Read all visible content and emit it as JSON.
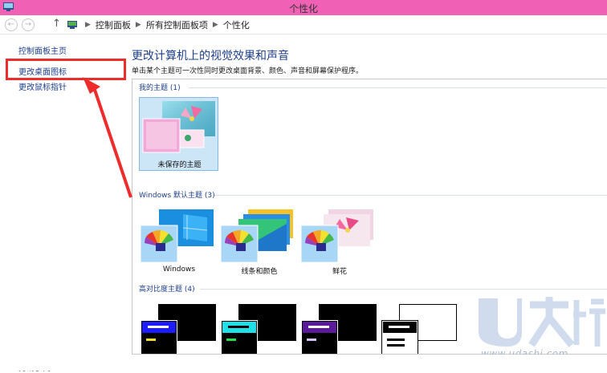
{
  "window": {
    "title": "个性化"
  },
  "address": {
    "crumbs": [
      "控制面板",
      "所有控制面板项",
      "个性化"
    ]
  },
  "sidebar": {
    "links": [
      "控制面板主页",
      "更改桌面图标",
      "更改鼠标指针"
    ],
    "bottom_text": "另请参阅"
  },
  "main": {
    "title": "更改计算机上的视觉效果和声音",
    "description": "单击某个主题可一次性同时更改桌面背景、颜色、声音和屏幕保护程序。"
  },
  "groups": {
    "my_themes": {
      "label": "我的主题 (1)",
      "items": [
        "未保存的主题"
      ]
    },
    "windows_themes": {
      "label": "Windows 默认主题 (3)",
      "items": [
        "Windows",
        "线条和颜色",
        "鲜花"
      ]
    },
    "high_contrast": {
      "label": "高对比度主题 (4)"
    }
  },
  "watermark": {
    "brand": "U大师",
    "url": "www.udashi.com"
  },
  "colors": {
    "titlebar": "#f061b6",
    "annotation_red": "#ee2c2c",
    "link_blue": "#1e3f8a"
  },
  "annotation": {
    "highlighted_item": "更改桌面图标"
  }
}
